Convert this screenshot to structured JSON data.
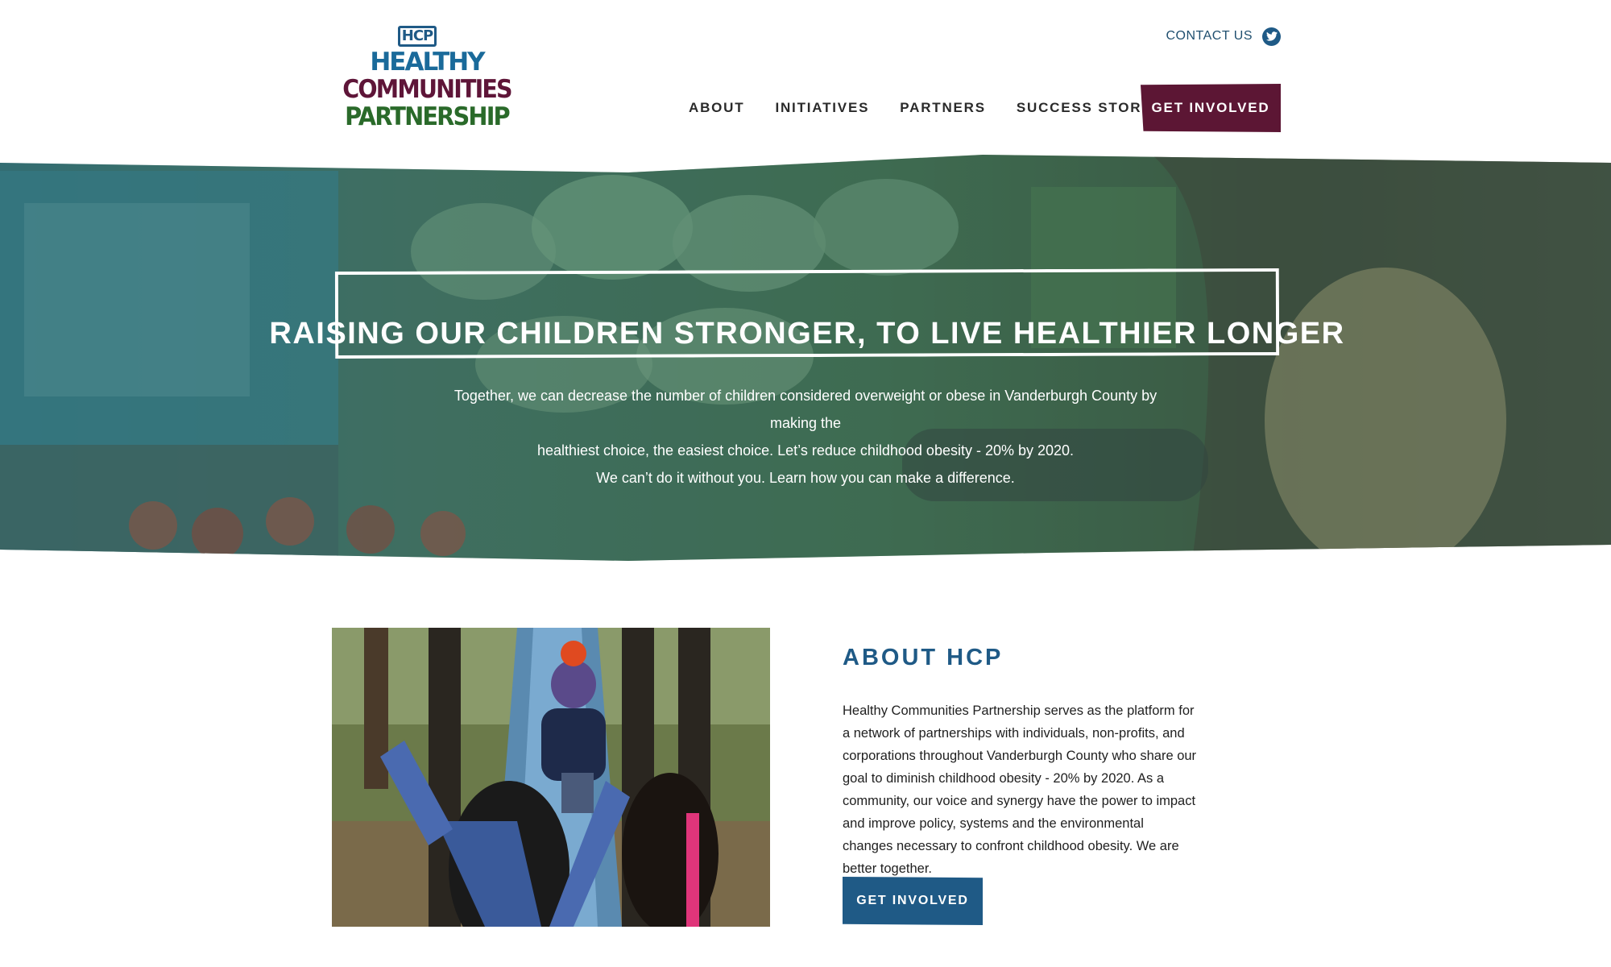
{
  "logo": {
    "badge": "HCP",
    "line1": "HEALTHY",
    "line2": "COMMUNITIES",
    "line3": "PARTNERSHIP"
  },
  "header": {
    "contact_label": "CONTACT US",
    "social_icon": "twitter-icon"
  },
  "nav": {
    "items": [
      {
        "label": "ABOUT"
      },
      {
        "label": "INITIATIVES"
      },
      {
        "label": "PARTNERS"
      },
      {
        "label": "SUCCESS STORIES"
      }
    ],
    "cta_label": "GET INVOLVED"
  },
  "hero": {
    "title": "RAISING OUR CHILDREN STRONGER, TO LIVE HEALTHIER LONGER",
    "text_line1": "Together, we can decrease the number of children considered overweight or obese in Vanderburgh County by making the",
    "text_line2": "healthiest choice, the easiest choice. Let’s reduce childhood obesity - 20% by 2020.",
    "text_line3": "We can’t do it without you. Learn how you can make a difference."
  },
  "about": {
    "heading": "ABOUT HCP",
    "body": "Healthy Communities Partnership serves as the platform for a network of partnerships with individuals, non-profits, and corporations throughout Vanderburgh County who share our goal to diminish childhood obesity - 20% by 2020. As a community, our voice and synergy have the power to impact and improve policy, systems and the environmental changes necessary to confront childhood obesity. We are better together.",
    "cta_label": "GET INVOLVED"
  },
  "colors": {
    "maroon": "#5c1634",
    "blue": "#1f5a86",
    "green": "#2a6a2a"
  }
}
